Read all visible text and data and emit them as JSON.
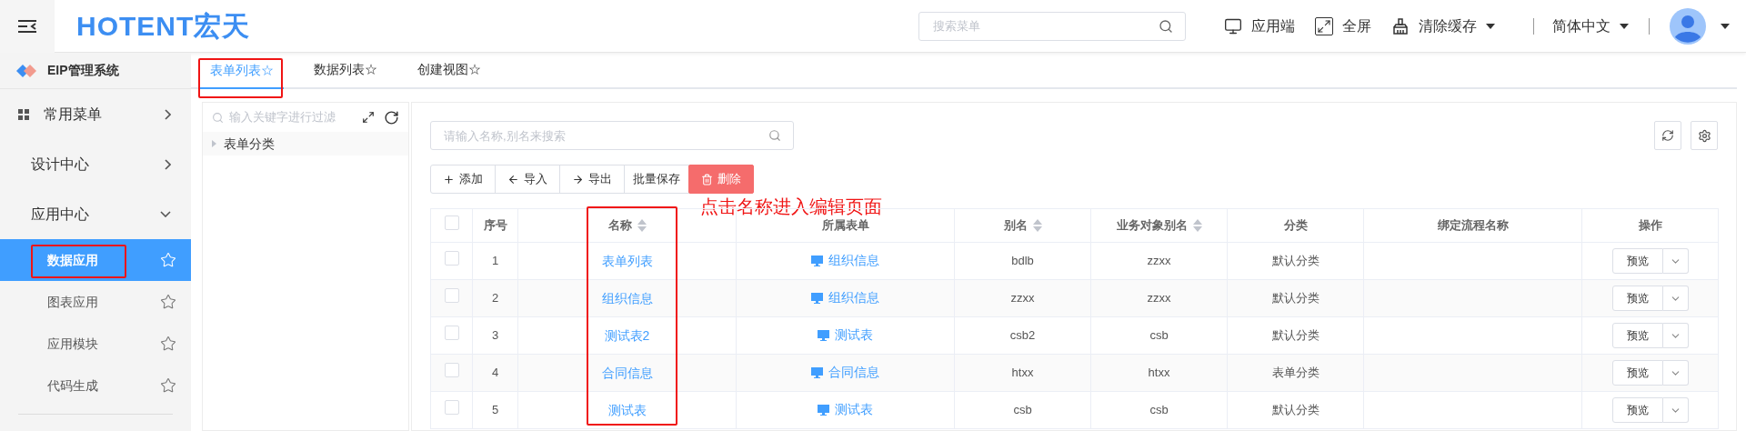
{
  "header": {
    "logo": "HOTENT宏天",
    "search": {
      "placeholder": "搜索菜单"
    },
    "actions": [
      {
        "kind": "app",
        "label": "应用端",
        "dropdown": false
      },
      {
        "kind": "fullscreen",
        "label": "全屏",
        "dropdown": false
      },
      {
        "kind": "cache",
        "label": "清除缓存",
        "dropdown": true
      },
      {
        "kind": "language",
        "label": "简体中文",
        "dropdown": true
      }
    ],
    "user": {
      "dropdown": true
    }
  },
  "sidebar": {
    "title": "EIP管理系统",
    "items": [
      {
        "kind": "favorites",
        "label": "常用菜单",
        "expanded": false
      },
      {
        "kind": "section",
        "label": "设计中心",
        "expanded": false
      },
      {
        "kind": "section",
        "label": "应用中心",
        "expanded": true,
        "children": [
          {
            "label": "数据应用",
            "selected": true,
            "annotated": true
          },
          {
            "label": "图表应用",
            "selected": false,
            "annotated": false
          },
          {
            "label": "应用模块",
            "selected": false,
            "annotated": false
          },
          {
            "label": "代码生成",
            "selected": false,
            "annotated": false
          }
        ]
      }
    ]
  },
  "tabs": [
    {
      "label": "表单列表☆",
      "selected": true,
      "annotated": true
    },
    {
      "label": "数据列表☆",
      "selected": false,
      "annotated": false
    },
    {
      "label": "创建视图☆",
      "selected": false,
      "annotated": false
    }
  ],
  "tree": {
    "placeholder": "输入关键字进行过滤",
    "nodes": [
      {
        "label": "表单分类",
        "expanded": false
      }
    ]
  },
  "list": {
    "search": {
      "placeholder": "请输入名称,别名来搜索"
    },
    "toolbar": [
      {
        "kind": "add",
        "label": "添加"
      },
      {
        "kind": "import",
        "label": "导入"
      },
      {
        "kind": "export",
        "label": "导出"
      },
      {
        "kind": "plain",
        "label": "批量保存"
      },
      {
        "kind": "danger",
        "label": "删除"
      }
    ],
    "annotation": {
      "text": "点击名称进入编辑页面"
    },
    "columns": [
      {
        "kind": "checkbox",
        "checked": false
      },
      {
        "kind": "text",
        "label": "序号",
        "sortable": false,
        "annotated": false
      },
      {
        "kind": "text",
        "label": "名称",
        "sortable": true,
        "annotated": true
      },
      {
        "kind": "text",
        "label": "所属表单",
        "sortable": false,
        "annotated": false
      },
      {
        "kind": "text",
        "label": "别名",
        "sortable": true,
        "annotated": false
      },
      {
        "kind": "text",
        "label": "业务对象别名",
        "sortable": true,
        "annotated": false
      },
      {
        "kind": "text",
        "label": "分类",
        "sortable": false,
        "annotated": false
      },
      {
        "kind": "text",
        "label": "绑定流程名称",
        "sortable": false,
        "annotated": false
      },
      {
        "kind": "text",
        "label": "操作",
        "sortable": false,
        "annotated": false
      }
    ],
    "rows": [
      {
        "checked": false,
        "index": "1",
        "name": "表单列表",
        "form": "组织信息",
        "alias": "bdlb",
        "bo_alias": "zzxx",
        "category": "默认分类",
        "action": "预览"
      },
      {
        "checked": false,
        "index": "2",
        "name": "组织信息",
        "form": "组织信息",
        "alias": "zzxx",
        "bo_alias": "zzxx",
        "category": "默认分类",
        "action": "预览"
      },
      {
        "checked": false,
        "index": "3",
        "name": "测试表2",
        "form": "测试表",
        "alias": "csb2",
        "bo_alias": "csb",
        "category": "默认分类",
        "action": "预览"
      },
      {
        "checked": false,
        "index": "4",
        "name": "合同信息",
        "form": "合同信息",
        "alias": "htxx",
        "bo_alias": "htxx",
        "category": "表单分类",
        "action": "预览"
      },
      {
        "checked": false,
        "index": "5",
        "name": "测试表",
        "form": "测试表",
        "alias": "csb",
        "bo_alias": "csb",
        "category": "默认分类",
        "action": "预览"
      }
    ]
  }
}
